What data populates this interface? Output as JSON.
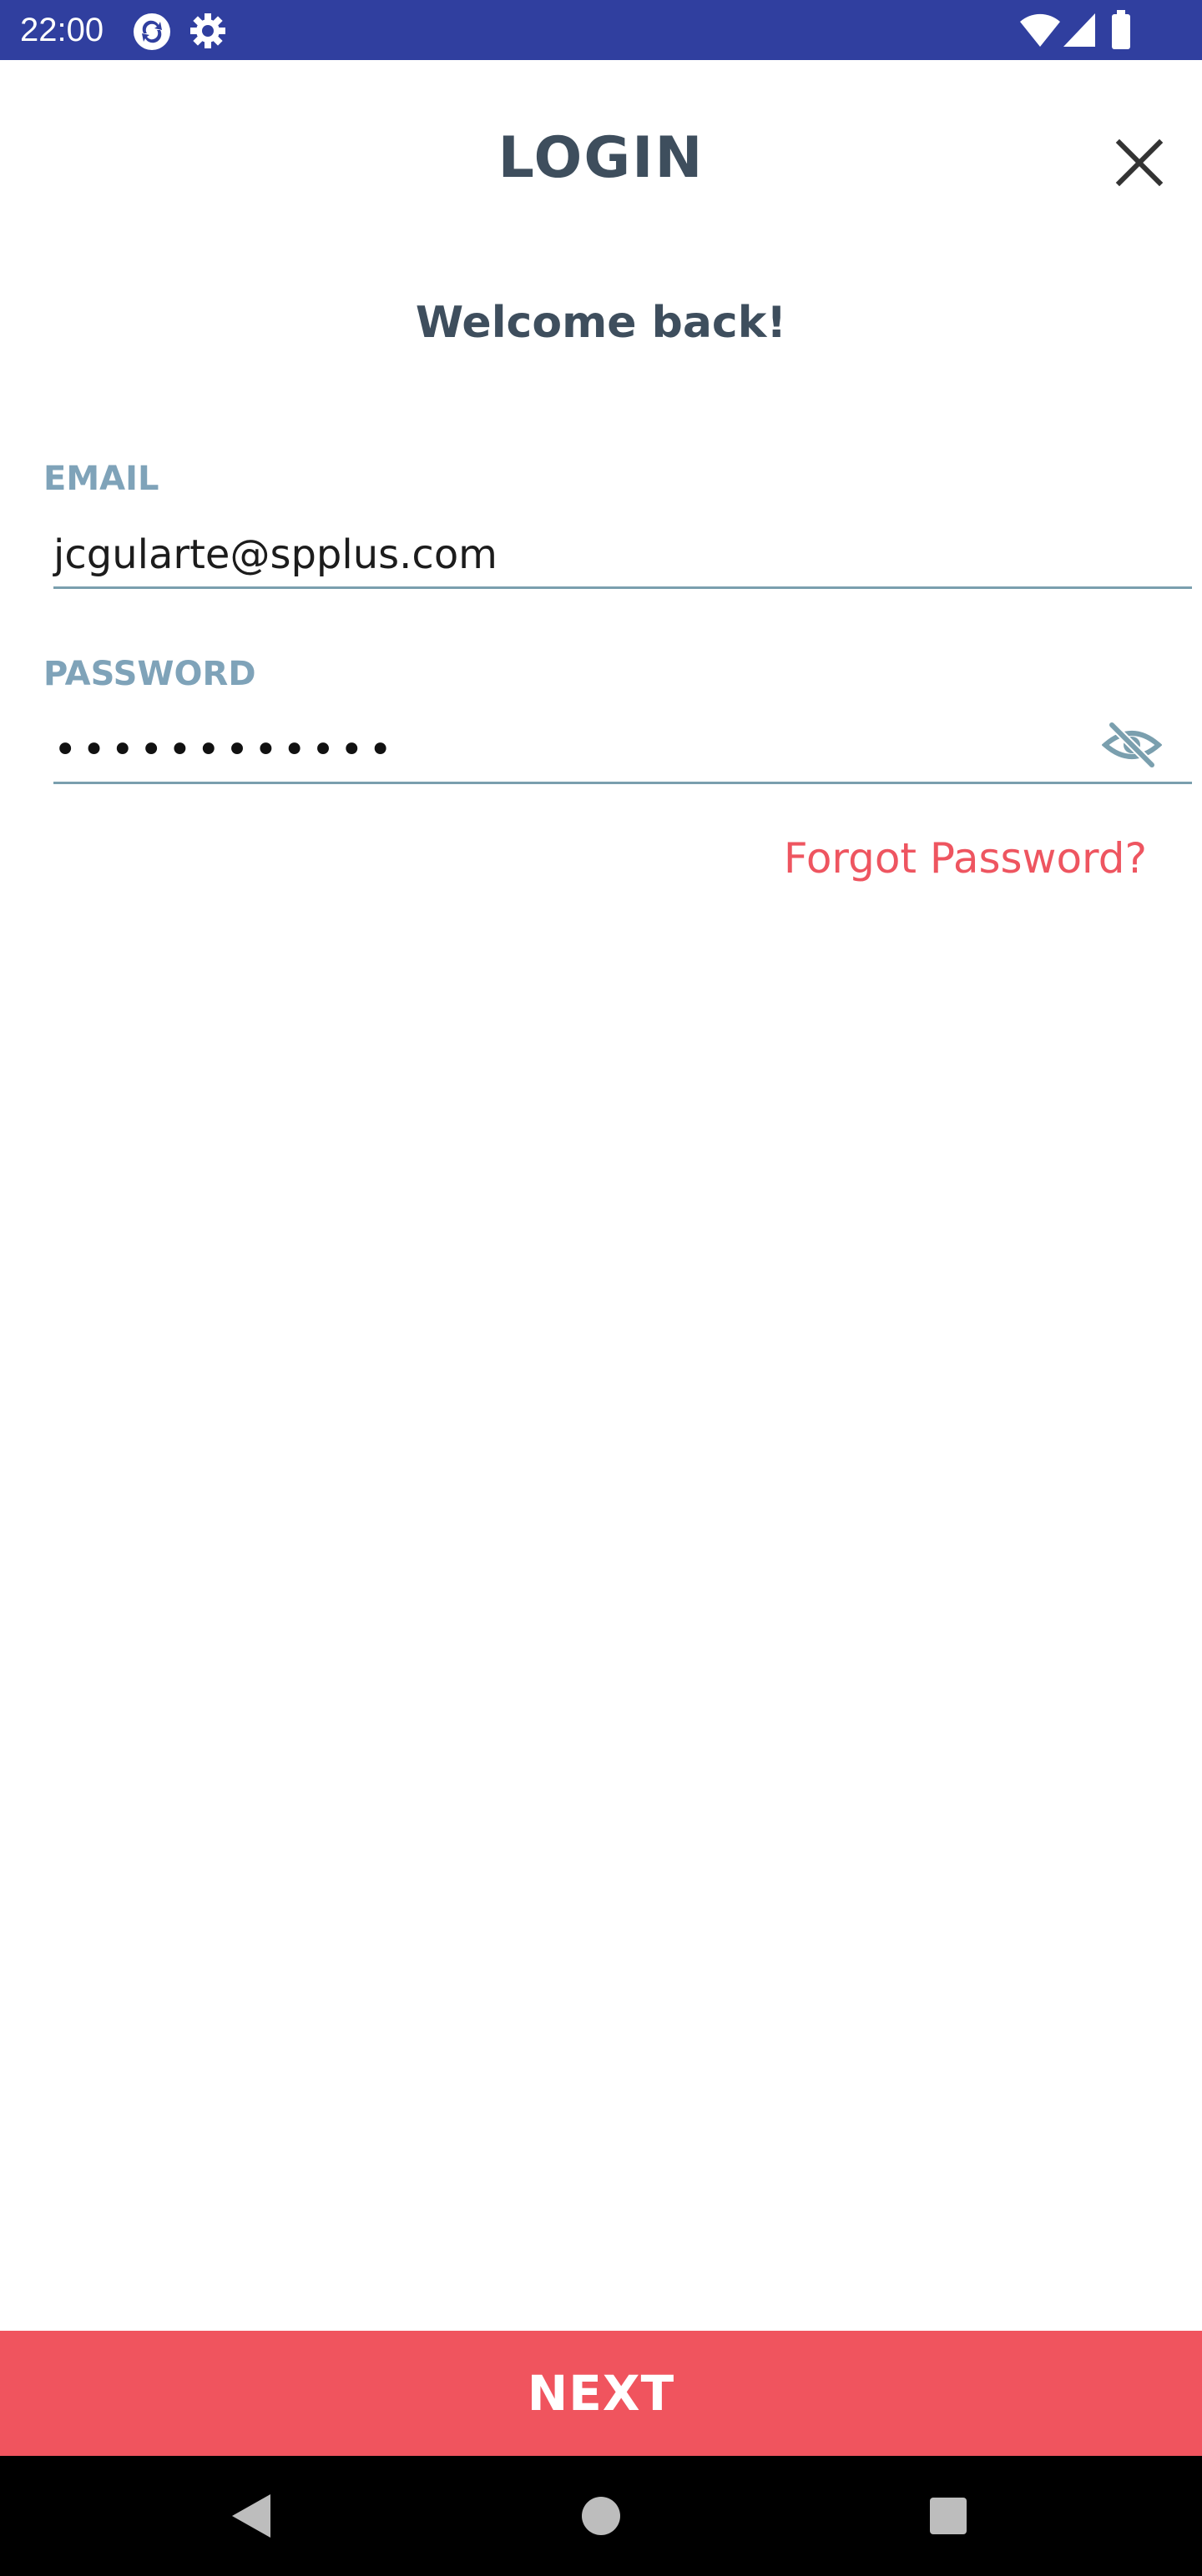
{
  "status_bar": {
    "time": "22:00",
    "left_icons": [
      "sync-app-icon",
      "settings-gear-icon"
    ],
    "right_icons": [
      "wifi-icon",
      "cellular-signal-icon",
      "battery-icon"
    ],
    "background": "#303f9f"
  },
  "header": {
    "title": "LOGIN",
    "close_icon": "close-icon"
  },
  "welcome_text": "Welcome back!",
  "email": {
    "label": "EMAIL",
    "value": "jcgularte@spplus.com"
  },
  "password": {
    "label": "PASSWORD",
    "masked_value": "••••••••••••",
    "toggle_icon": "eye-off-icon"
  },
  "forgot_password": "Forgot Password?",
  "next_button": "NEXT",
  "nav_bar": {
    "buttons": [
      "back-icon",
      "home-icon",
      "recents-icon"
    ]
  },
  "colors": {
    "accent": "#f0545e",
    "heading": "#3e4e5d",
    "label": "#7fa3b9",
    "underline": "#7a9fae",
    "status_bar": "#303f9f"
  }
}
